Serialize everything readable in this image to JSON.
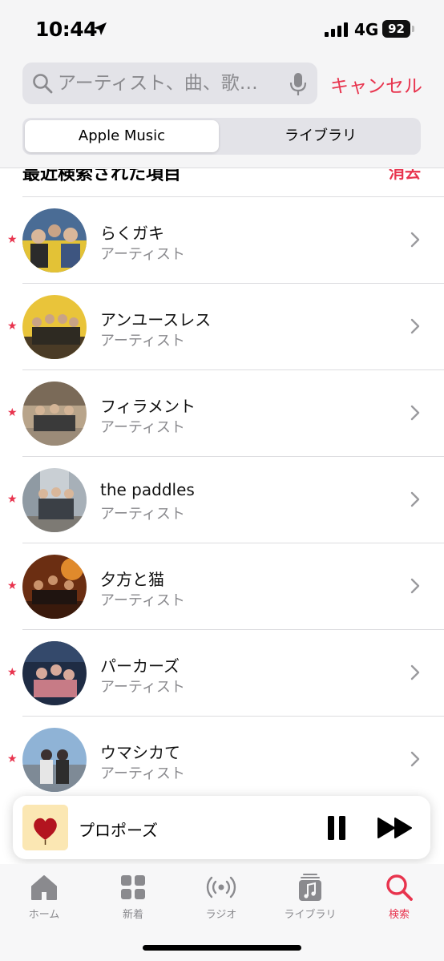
{
  "status_bar": {
    "time": "10:44",
    "network": "4G",
    "battery": "92"
  },
  "search": {
    "placeholder": "アーティスト、曲、歌…",
    "cancel_label": "キャンセル"
  },
  "segments": {
    "apple_music": "Apple Music",
    "library": "ライブラリ",
    "selected": "Apple Music"
  },
  "recent": {
    "title": "最近検索された項目",
    "clear_label": "消去",
    "items": [
      {
        "name": "らくガキ",
        "type": "アーティスト"
      },
      {
        "name": "アンユースレス",
        "type": "アーティスト"
      },
      {
        "name": "フィラメント",
        "type": "アーティスト"
      },
      {
        "name": "the paddles",
        "type": "アーティスト"
      },
      {
        "name": "夕方と猫",
        "type": "アーティスト"
      },
      {
        "name": "パーカーズ",
        "type": "アーティスト"
      },
      {
        "name": "ウマシカて",
        "type": "アーティスト"
      }
    ]
  },
  "mini_player": {
    "track_title": "プロポーズ",
    "state": "playing"
  },
  "tab_bar": {
    "tabs": [
      {
        "label": "ホーム",
        "icon": "home-icon"
      },
      {
        "label": "新着",
        "icon": "grid-icon"
      },
      {
        "label": "ラジオ",
        "icon": "radio-icon"
      },
      {
        "label": "ライブラリ",
        "icon": "library-icon"
      },
      {
        "label": "検索",
        "icon": "search-icon"
      }
    ],
    "active": "検索"
  },
  "colors": {
    "accent": "#e8344e",
    "secondary_text": "#8a8a8e",
    "header_bg": "#f5f5f6"
  }
}
